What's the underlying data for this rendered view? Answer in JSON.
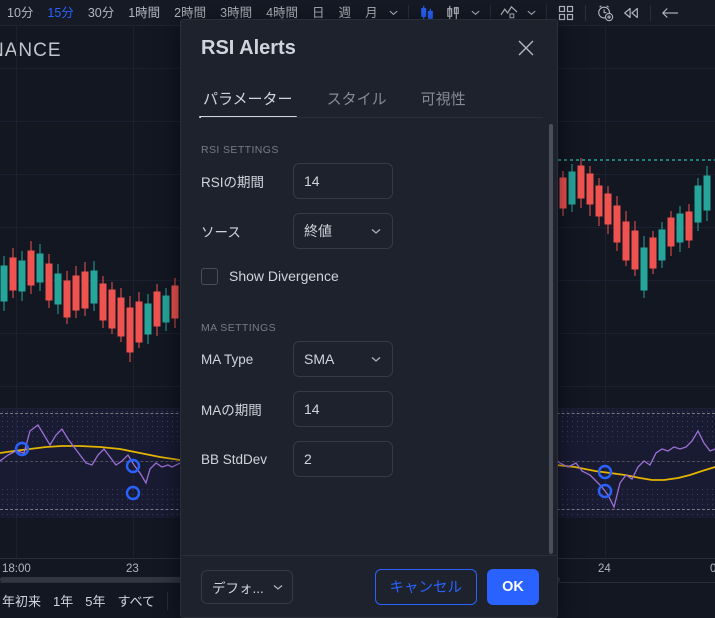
{
  "toolbar": {
    "timeframes": [
      {
        "label": "10分",
        "active": false
      },
      {
        "label": "15分",
        "active": true
      },
      {
        "label": "30分",
        "active": false
      },
      {
        "label": "1時間",
        "active": false
      },
      {
        "label": "2時間",
        "active": false
      },
      {
        "label": "3時間",
        "active": false
      },
      {
        "label": "4時間",
        "active": false
      },
      {
        "label": "日",
        "active": false
      },
      {
        "label": "週",
        "active": false
      },
      {
        "label": "月",
        "active": false
      }
    ],
    "icons": [
      {
        "name": "chevron-down-icon"
      },
      {
        "name": "candlestick-chart-icon"
      },
      {
        "name": "bar-chart-icon"
      },
      {
        "name": "chevron-down-icon"
      },
      {
        "name": "line-chart-indicator-icon"
      },
      {
        "name": "chevron-down-icon"
      },
      {
        "name": "layouts-grid-icon"
      },
      {
        "name": "alarm-add-icon"
      },
      {
        "name": "replay-rewind-icon"
      },
      {
        "name": "undo-arrow-icon"
      }
    ]
  },
  "chart": {
    "watermark": "NANCE",
    "time_axis": [
      "18:00",
      "23",
      "24",
      "0"
    ],
    "ranges": [
      "年初来",
      "1年",
      "5年",
      "すべて"
    ]
  },
  "dialog": {
    "title": "RSI Alerts",
    "close_icon": "close-icon",
    "tabs": [
      {
        "label": "パラメーター",
        "active": true
      },
      {
        "label": "スタイル",
        "active": false
      },
      {
        "label": "可視性",
        "active": false
      }
    ],
    "sections": [
      {
        "title": "RSI SETTINGS",
        "rows": [
          {
            "label": "RSIの期間",
            "type": "input",
            "value": "14"
          },
          {
            "label": "ソース",
            "type": "select",
            "value": "終値"
          },
          {
            "label": "Show Divergence",
            "type": "checkbox",
            "checked": false
          }
        ]
      },
      {
        "title": "MA SETTINGS",
        "rows": [
          {
            "label": "MA Type",
            "type": "select",
            "value": "SMA"
          },
          {
            "label": "MAの期間",
            "type": "input",
            "value": "14"
          },
          {
            "label": "BB StdDev",
            "type": "input",
            "value": "2"
          }
        ]
      }
    ],
    "footer": {
      "preset_label": "デフォ...",
      "cancel_label": "キャンセル",
      "ok_label": "OK"
    }
  },
  "colors": {
    "accent": "#2962ff",
    "panel": "#1e222d",
    "background": "#131722",
    "text": "#d1d4dc",
    "muted": "#787b86",
    "bull": "#26a69a",
    "bear": "#ef5350",
    "rsi_line": "#9b6fd4",
    "ma_line": "#e4b400"
  }
}
